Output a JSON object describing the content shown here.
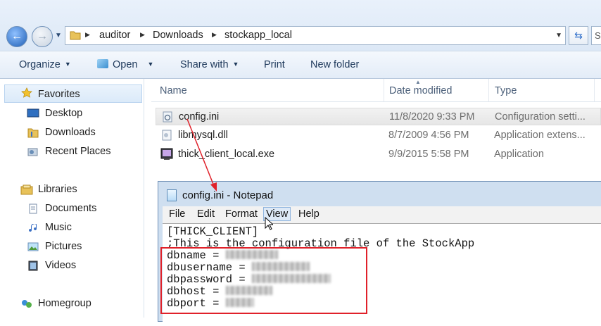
{
  "address": {
    "breadcrumbs": [
      "auditor",
      "Downloads",
      "stockapp_local"
    ],
    "search_placeholder": "S"
  },
  "toolbar": {
    "organize": "Organize",
    "open": "Open",
    "share_with": "Share with",
    "print": "Print",
    "new_folder": "New folder"
  },
  "nav": {
    "favorites": "Favorites",
    "desktop": "Desktop",
    "downloads": "Downloads",
    "recent_places": "Recent Places",
    "libraries": "Libraries",
    "documents": "Documents",
    "music": "Music",
    "pictures": "Pictures",
    "videos": "Videos",
    "homegroup": "Homegroup"
  },
  "columns": {
    "name": "Name",
    "date": "Date modified",
    "type": "Type"
  },
  "files": [
    {
      "name": "config.ini",
      "date": "11/8/2020 9:33 PM",
      "type": "Configuration setti..."
    },
    {
      "name": "libmysql.dll",
      "date": "8/7/2009 4:56 PM",
      "type": "Application extens..."
    },
    {
      "name": "thick_client_local.exe",
      "date": "9/9/2015 5:58 PM",
      "type": "Application"
    }
  ],
  "notepad": {
    "title": "config.ini - Notepad",
    "menu": [
      "File",
      "Edit",
      "Format",
      "View",
      "Help"
    ],
    "lines": [
      "[THICK_CLIENT]",
      ";This is the configuration file of the StockApp",
      "dbname = ",
      "dbusername = ",
      "dbpassword = ",
      "dbhost = ",
      "dbport = "
    ]
  },
  "colors": {
    "highlight_box": "#e0212a",
    "arrow": "#e0212a"
  }
}
